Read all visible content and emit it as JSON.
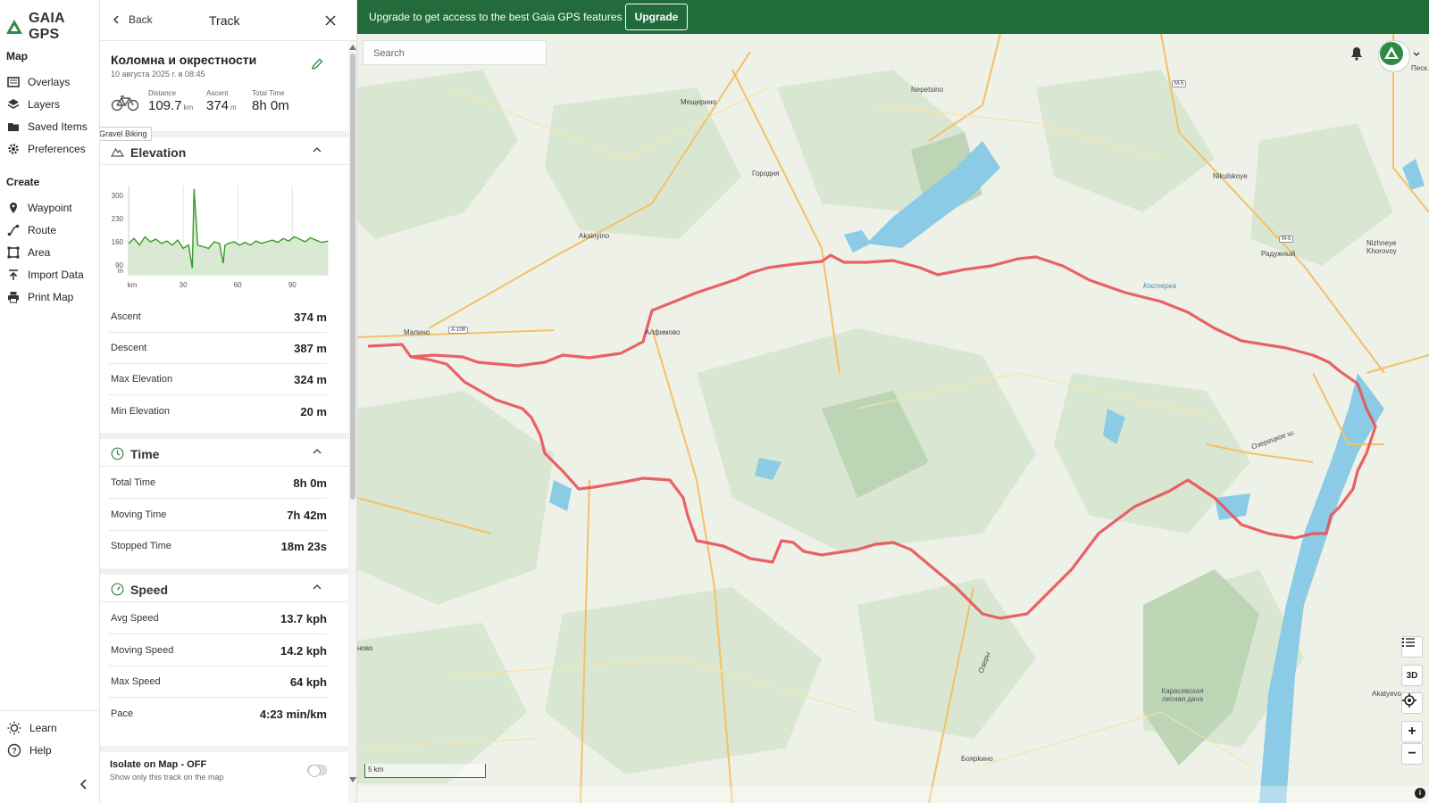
{
  "brand": {
    "name": "GAIA GPS"
  },
  "nav": {
    "map_section": "Map",
    "map_items": [
      {
        "label": "Overlays",
        "icon": "overlays-icon"
      },
      {
        "label": "Layers",
        "icon": "layers-icon"
      },
      {
        "label": "Saved Items",
        "icon": "folder-icon"
      },
      {
        "label": "Preferences",
        "icon": "gear-icon"
      }
    ],
    "create_section": "Create",
    "create_items": [
      {
        "label": "Waypoint",
        "icon": "pin-icon"
      },
      {
        "label": "Route",
        "icon": "route-icon"
      },
      {
        "label": "Area",
        "icon": "area-icon"
      },
      {
        "label": "Import Data",
        "icon": "upload-icon"
      },
      {
        "label": "Print Map",
        "icon": "printer-icon"
      }
    ],
    "bottom_items": [
      {
        "label": "Learn",
        "icon": "lightbulb-icon"
      },
      {
        "label": "Help",
        "icon": "help-icon"
      }
    ]
  },
  "panel": {
    "back_label": "Back",
    "title": "Track",
    "track_name": "Коломна и окрестности",
    "track_date": "10 августа 2025 г. в 08:45",
    "activity_tooltip": "Gravel Biking",
    "stats": [
      {
        "label": "Distance",
        "value": "109.7",
        "unit": "km"
      },
      {
        "label": "Ascent",
        "value": "374",
        "unit": "m"
      },
      {
        "label": "Total Time",
        "value": "8h 0m",
        "unit": ""
      }
    ],
    "elevation": {
      "title": "Elevation",
      "rows": [
        {
          "key": "Ascent",
          "value": "374 m"
        },
        {
          "key": "Descent",
          "value": "387 m"
        },
        {
          "key": "Max Elevation",
          "value": "324 m"
        },
        {
          "key": "Min Elevation",
          "value": "20 m"
        }
      ]
    },
    "time": {
      "title": "Time",
      "rows": [
        {
          "key": "Total Time",
          "value": "8h 0m"
        },
        {
          "key": "Moving Time",
          "value": "7h 42m"
        },
        {
          "key": "Stopped Time",
          "value": "18m 23s"
        }
      ]
    },
    "speed": {
      "title": "Speed",
      "rows": [
        {
          "key": "Avg Speed",
          "value": "13.7 kph"
        },
        {
          "key": "Moving Speed",
          "value": "14.2 kph"
        },
        {
          "key": "Max Speed",
          "value": "64 kph"
        },
        {
          "key": "Pace",
          "value": "4:23 min/km"
        }
      ]
    },
    "isolate": {
      "title": "Isolate on Map - OFF",
      "subtitle": "Show only this track on the map",
      "enabled": false
    }
  },
  "chart_data": {
    "type": "area",
    "xlabel": "km",
    "ylabel": "m",
    "x_ticks": [
      "30",
      "60",
      "90"
    ],
    "y_ticks": [
      "300",
      "230",
      "160",
      "90"
    ],
    "ylim": [
      60,
      330
    ],
    "xlim": [
      0,
      110
    ],
    "line_color": "#3a9a2a",
    "x": [
      0,
      3,
      6,
      9,
      12,
      15,
      18,
      21,
      24,
      27,
      30,
      33,
      35,
      36,
      38,
      41,
      44,
      47,
      50,
      52,
      53,
      55,
      58,
      61,
      64,
      67,
      70,
      73,
      76,
      79,
      82,
      85,
      88,
      91,
      94,
      97,
      100,
      103,
      106,
      109.7
    ],
    "values": [
      155,
      170,
      150,
      175,
      160,
      168,
      155,
      162,
      150,
      165,
      140,
      150,
      80,
      320,
      150,
      145,
      140,
      160,
      155,
      95,
      150,
      155,
      160,
      150,
      158,
      150,
      162,
      155,
      160,
      165,
      158,
      170,
      162,
      175,
      168,
      160,
      172,
      165,
      158,
      162
    ]
  },
  "banner": {
    "text": "Upgrade to get access to the best Gaia GPS features",
    "button": "Upgrade"
  },
  "map": {
    "search_placeholder": "Search",
    "scale_label": "5 km",
    "btn_3d": "3D",
    "btn_zoom_in": "+",
    "btn_zoom_out": "−",
    "info": "i",
    "track_color": "#e8555a",
    "places": [
      "Мещерино",
      "Nepetsino",
      "Городня",
      "Aksinyino",
      "Малино",
      "Алфимово",
      "Nikulskoye",
      "Радужный",
      "Nizhneye Khorovoy",
      "Песк...",
      "Боярkино",
      "Akatyevo",
      "Карасевская лесная дача",
      "Озеры",
      "Костерка",
      "Озерецкое ш.",
      "ново"
    ],
    "roads": [
      "M-5",
      "M-5",
      "A-108"
    ]
  }
}
